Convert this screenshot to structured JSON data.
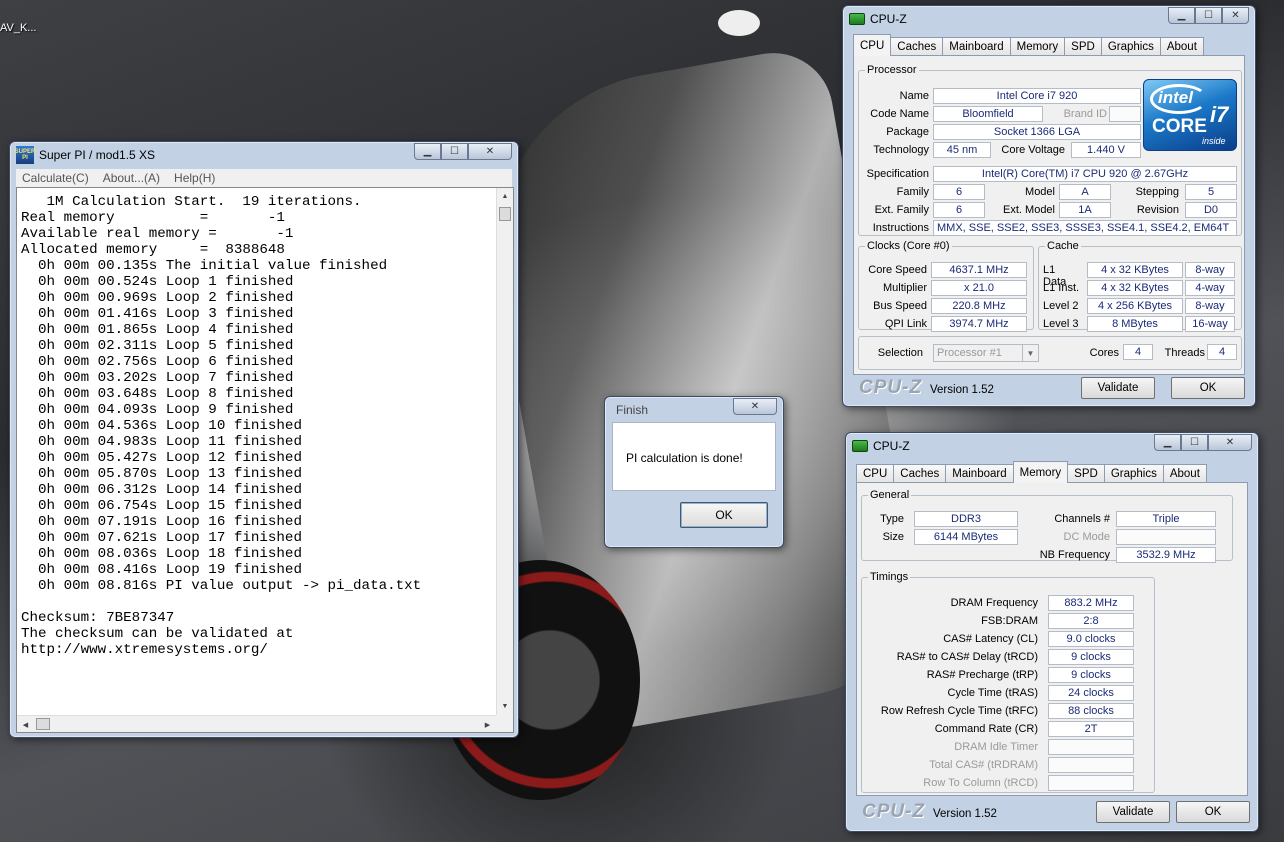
{
  "desktop": {
    "icon_label": "AV_K..."
  },
  "superpi": {
    "title": "Super PI / mod1.5 XS",
    "icon_text": "SUPER PI",
    "menu": [
      "Calculate(C)",
      "About...(A)",
      "Help(H)"
    ],
    "console_lines": [
      "   1M Calculation Start.  19 iterations.",
      "Real memory          =       -1",
      "Available real memory =       -1",
      "Allocated memory     =  8388648",
      "  0h 00m 00.135s The initial value finished",
      "  0h 00m 00.524s Loop 1 finished",
      "  0h 00m 00.969s Loop 2 finished",
      "  0h 00m 01.416s Loop 3 finished",
      "  0h 00m 01.865s Loop 4 finished",
      "  0h 00m 02.311s Loop 5 finished",
      "  0h 00m 02.756s Loop 6 finished",
      "  0h 00m 03.202s Loop 7 finished",
      "  0h 00m 03.648s Loop 8 finished",
      "  0h 00m 04.093s Loop 9 finished",
      "  0h 00m 04.536s Loop 10 finished",
      "  0h 00m 04.983s Loop 11 finished",
      "  0h 00m 05.427s Loop 12 finished",
      "  0h 00m 05.870s Loop 13 finished",
      "  0h 00m 06.312s Loop 14 finished",
      "  0h 00m 06.754s Loop 15 finished",
      "  0h 00m 07.191s Loop 16 finished",
      "  0h 00m 07.621s Loop 17 finished",
      "  0h 00m 08.036s Loop 18 finished",
      "  0h 00m 08.416s Loop 19 finished",
      "  0h 00m 08.816s PI value output -> pi_data.txt",
      "",
      "Checksum: 7BE87347",
      "The checksum can be validated at",
      "http://www.xtremesystems.org/"
    ]
  },
  "finish_dialog": {
    "title": "Finish",
    "message": "PI calculation is done!",
    "ok_label": "OK"
  },
  "cpuz_cpu": {
    "title": "CPU-Z",
    "tabs": [
      "CPU",
      "Caches",
      "Mainboard",
      "Memory",
      "SPD",
      "Graphics",
      "About"
    ],
    "active_tab": "CPU",
    "processor": {
      "legend": "Processor",
      "name_label": "Name",
      "name": "Intel Core i7 920",
      "codename_label": "Code Name",
      "codename": "Bloomfield",
      "brandid_label": "Brand ID",
      "brandid": "",
      "package_label": "Package",
      "package": "Socket 1366 LGA",
      "technology_label": "Technology",
      "technology": "45 nm",
      "voltage_label": "Core Voltage",
      "voltage": "1.440 V",
      "spec_label": "Specification",
      "spec": "Intel(R) Core(TM) i7 CPU        920  @ 2.67GHz",
      "family_label": "Family",
      "family": "6",
      "model_label": "Model",
      "model": "A",
      "stepping_label": "Stepping",
      "stepping": "5",
      "extfamily_label": "Ext. Family",
      "extfamily": "6",
      "extmodel_label": "Ext. Model",
      "extmodel": "1A",
      "revision_label": "Revision",
      "revision": "D0",
      "instructions_label": "Instructions",
      "instructions": "MMX, SSE, SSE2, SSE3, SSSE3, SSE4.1, SSE4.2, EM64T"
    },
    "intel_logo": {
      "brand": "intel",
      "line": "CORE",
      "model": "i7",
      "tag": "inside"
    },
    "clocks": {
      "legend": "Clocks (Core #0)",
      "corespeed_label": "Core Speed",
      "corespeed": "4637.1 MHz",
      "multiplier_label": "Multiplier",
      "multiplier": "x 21.0",
      "busspeed_label": "Bus Speed",
      "busspeed": "220.8 MHz",
      "qpi_label": "QPI Link",
      "qpi": "3974.7 MHz"
    },
    "cache": {
      "legend": "Cache",
      "rows": [
        {
          "label": "L1 Data",
          "size": "4 x 32 KBytes",
          "way": "8-way"
        },
        {
          "label": "L1 Inst.",
          "size": "4 x 32 KBytes",
          "way": "4-way"
        },
        {
          "label": "Level 2",
          "size": "4 x 256 KBytes",
          "way": "8-way"
        },
        {
          "label": "Level 3",
          "size": "8 MBytes",
          "way": "16-way"
        }
      ]
    },
    "selection_label": "Selection",
    "selection": "Processor #1",
    "cores_label": "Cores",
    "cores": "4",
    "threads_label": "Threads",
    "threads": "4",
    "logo": "CPU-Z",
    "version": "Version 1.52",
    "validate_label": "Validate",
    "ok_label": "OK"
  },
  "cpuz_mem": {
    "title": "CPU-Z",
    "tabs": [
      "CPU",
      "Caches",
      "Mainboard",
      "Memory",
      "SPD",
      "Graphics",
      "About"
    ],
    "active_tab": "Memory",
    "general": {
      "legend": "General",
      "type_label": "Type",
      "type": "DDR3",
      "size_label": "Size",
      "size": "6144 MBytes",
      "channels_label": "Channels #",
      "channels": "Triple",
      "dcmode_label": "DC Mode",
      "dcmode": "",
      "nbfreq_label": "NB Frequency",
      "nbfreq": "3532.9 MHz"
    },
    "timings": {
      "legend": "Timings",
      "rows": [
        {
          "label": "DRAM Frequency",
          "value": "883.2 MHz",
          "dim": false
        },
        {
          "label": "FSB:DRAM",
          "value": "2:8",
          "dim": false
        },
        {
          "label": "CAS# Latency (CL)",
          "value": "9.0 clocks",
          "dim": false
        },
        {
          "label": "RAS# to CAS# Delay (tRCD)",
          "value": "9 clocks",
          "dim": false
        },
        {
          "label": "RAS# Precharge (tRP)",
          "value": "9 clocks",
          "dim": false
        },
        {
          "label": "Cycle Time (tRAS)",
          "value": "24 clocks",
          "dim": false
        },
        {
          "label": "Row Refresh Cycle Time (tRFC)",
          "value": "88 clocks",
          "dim": false
        },
        {
          "label": "Command Rate (CR)",
          "value": "2T",
          "dim": false
        },
        {
          "label": "DRAM Idle Timer",
          "value": "",
          "dim": true
        },
        {
          "label": "Total CAS# (tRDRAM)",
          "value": "",
          "dim": true
        },
        {
          "label": "Row To Column (tRCD)",
          "value": "",
          "dim": true
        }
      ]
    },
    "logo": "CPU-Z",
    "version": "Version 1.52",
    "validate_label": "Validate",
    "ok_label": "OK"
  }
}
